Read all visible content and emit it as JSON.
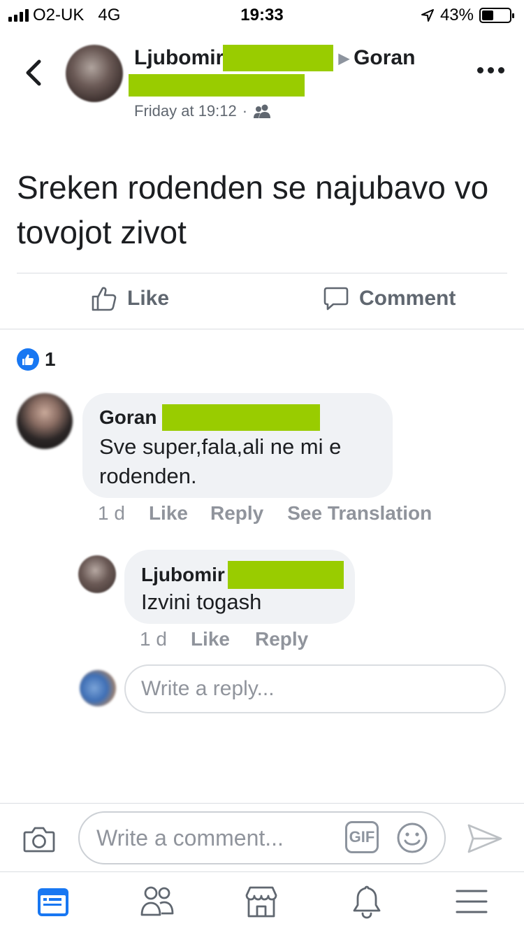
{
  "status_bar": {
    "carrier": "O2-UK",
    "network": "4G",
    "time": "19:33",
    "battery_percent": "43%",
    "battery_level": 0.43
  },
  "post": {
    "author": "Ljubomir S",
    "arrow": "▶",
    "target": "Goran",
    "timestamp": "Friday at 19:12",
    "separator": "·",
    "audience_icon": "friends-icon",
    "text": "Sreken rodenden se najubavo vo tovojot zivot"
  },
  "actions": {
    "like_label": "Like",
    "comment_label": "Comment"
  },
  "reactions": {
    "icon": "like-reaction-icon",
    "count": "1"
  },
  "comments": [
    {
      "name": "Goran",
      "text": "Sve super,fala,ali ne mi e rodenden.",
      "time": "1 d",
      "like_label": "Like",
      "reply_label": "Reply",
      "translate_label": "See Translation"
    },
    {
      "name": "Ljubomir",
      "text": "Izvini togash",
      "time": "1 d",
      "like_label": "Like",
      "reply_label": "Reply"
    }
  ],
  "reply_input": {
    "placeholder": "Write a reply..."
  },
  "composer": {
    "placeholder": "Write a comment...",
    "gif_label": "GIF"
  },
  "tabs": [
    "news-feed-icon",
    "friends-icon",
    "marketplace-icon",
    "notifications-icon",
    "menu-icon"
  ],
  "colors": {
    "accent": "#1877f2",
    "redaction": "#99cc00",
    "secondary_text": "#606770"
  }
}
